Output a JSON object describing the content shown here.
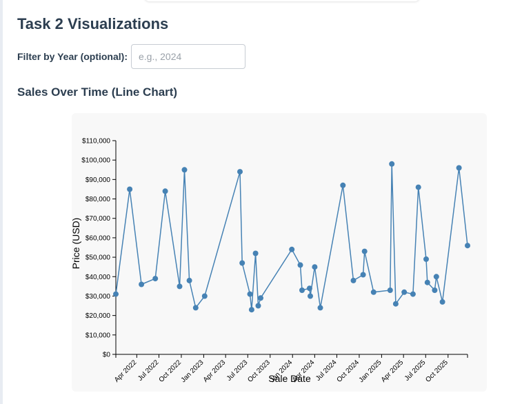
{
  "page": {
    "title": "Task 2 Visualizations",
    "filter_label": "Filter by Year (optional):",
    "filter_placeholder": "e.g., 2024",
    "filter_value": "",
    "chart_heading": "Sales Over Time (Line Chart)"
  },
  "chart_data": {
    "type": "line",
    "title": "Sales Over Time (Line Chart)",
    "xlabel": "Sale Date",
    "ylabel": "Price (USD)",
    "xlim": [
      "2022-01-05",
      "2025-12-20"
    ],
    "ylim": [
      0,
      110000
    ],
    "y_ticks": [
      "$0",
      "$10,000",
      "$20,000",
      "$30,000",
      "$40,000",
      "$50,000",
      "$60,000",
      "$70,000",
      "$80,000",
      "$90,000",
      "$100,000",
      "$110,000"
    ],
    "x_ticks": [
      {
        "date": "2022-04-01",
        "label": "Apr 2022"
      },
      {
        "date": "2022-07-01",
        "label": "Jul 2022"
      },
      {
        "date": "2022-10-01",
        "label": "Oct 2022"
      },
      {
        "date": "2023-01-01",
        "label": "Jan 2023"
      },
      {
        "date": "2023-04-01",
        "label": "Apr 2023"
      },
      {
        "date": "2023-07-01",
        "label": "Jul 2023"
      },
      {
        "date": "2023-10-01",
        "label": "Oct 2023"
      },
      {
        "date": "2024-01-01",
        "label": "Jan 2024"
      },
      {
        "date": "2024-04-01",
        "label": "Apr 2024"
      },
      {
        "date": "2024-07-01",
        "label": "Jul 2024"
      },
      {
        "date": "2024-10-01",
        "label": "Oct 2024"
      },
      {
        "date": "2025-01-01",
        "label": "Jan 2025"
      },
      {
        "date": "2025-04-01",
        "label": "Apr 2025"
      },
      {
        "date": "2025-07-01",
        "label": "Jul 2025"
      },
      {
        "date": "2025-10-01",
        "label": "Oct 2025"
      }
    ],
    "grid": false,
    "line_color": "#4682b4",
    "series": [
      {
        "points": [
          {
            "x": "2022-01-05",
            "y": 31000
          },
          {
            "x": "2022-03-03",
            "y": 85000
          },
          {
            "x": "2022-04-20",
            "y": 36000
          },
          {
            "x": "2022-06-16",
            "y": 39000
          },
          {
            "x": "2022-07-27",
            "y": 84000
          },
          {
            "x": "2022-09-24",
            "y": 35000
          },
          {
            "x": "2022-10-14",
            "y": 95000
          },
          {
            "x": "2022-11-03",
            "y": 38000
          },
          {
            "x": "2022-11-29",
            "y": 24000
          },
          {
            "x": "2023-01-05",
            "y": 30000
          },
          {
            "x": "2023-05-30",
            "y": 94000
          },
          {
            "x": "2023-06-08",
            "y": 47000
          },
          {
            "x": "2023-07-10",
            "y": 31000
          },
          {
            "x": "2023-07-17",
            "y": 23000
          },
          {
            "x": "2023-08-02",
            "y": 52000
          },
          {
            "x": "2023-08-13",
            "y": 25000
          },
          {
            "x": "2023-08-23",
            "y": 29000
          },
          {
            "x": "2023-12-29",
            "y": 54000
          },
          {
            "x": "2024-02-02",
            "y": 46000
          },
          {
            "x": "2024-02-09",
            "y": 33000
          },
          {
            "x": "2024-03-11",
            "y": 34000
          },
          {
            "x": "2024-03-14",
            "y": 30000
          },
          {
            "x": "2024-04-01",
            "y": 45000
          },
          {
            "x": "2024-04-24",
            "y": 24000
          },
          {
            "x": "2024-07-26",
            "y": 87000
          },
          {
            "x": "2024-09-07",
            "y": 38000
          },
          {
            "x": "2024-10-17",
            "y": 41000
          },
          {
            "x": "2024-10-23",
            "y": 53000
          },
          {
            "x": "2024-11-29",
            "y": 32000
          },
          {
            "x": "2025-02-05",
            "y": 33000
          },
          {
            "x": "2025-02-12",
            "y": 98000
          },
          {
            "x": "2025-02-28",
            "y": 26000
          },
          {
            "x": "2025-04-04",
            "y": 32000
          },
          {
            "x": "2025-05-10",
            "y": 31000
          },
          {
            "x": "2025-06-01",
            "y": 86000
          },
          {
            "x": "2025-07-03",
            "y": 49000
          },
          {
            "x": "2025-07-08",
            "y": 37000
          },
          {
            "x": "2025-08-07",
            "y": 33000
          },
          {
            "x": "2025-08-14",
            "y": 40000
          },
          {
            "x": "2025-09-08",
            "y": 27000
          },
          {
            "x": "2025-11-15",
            "y": 96000
          },
          {
            "x": "2025-12-20",
            "y": 56000
          }
        ]
      }
    ]
  }
}
